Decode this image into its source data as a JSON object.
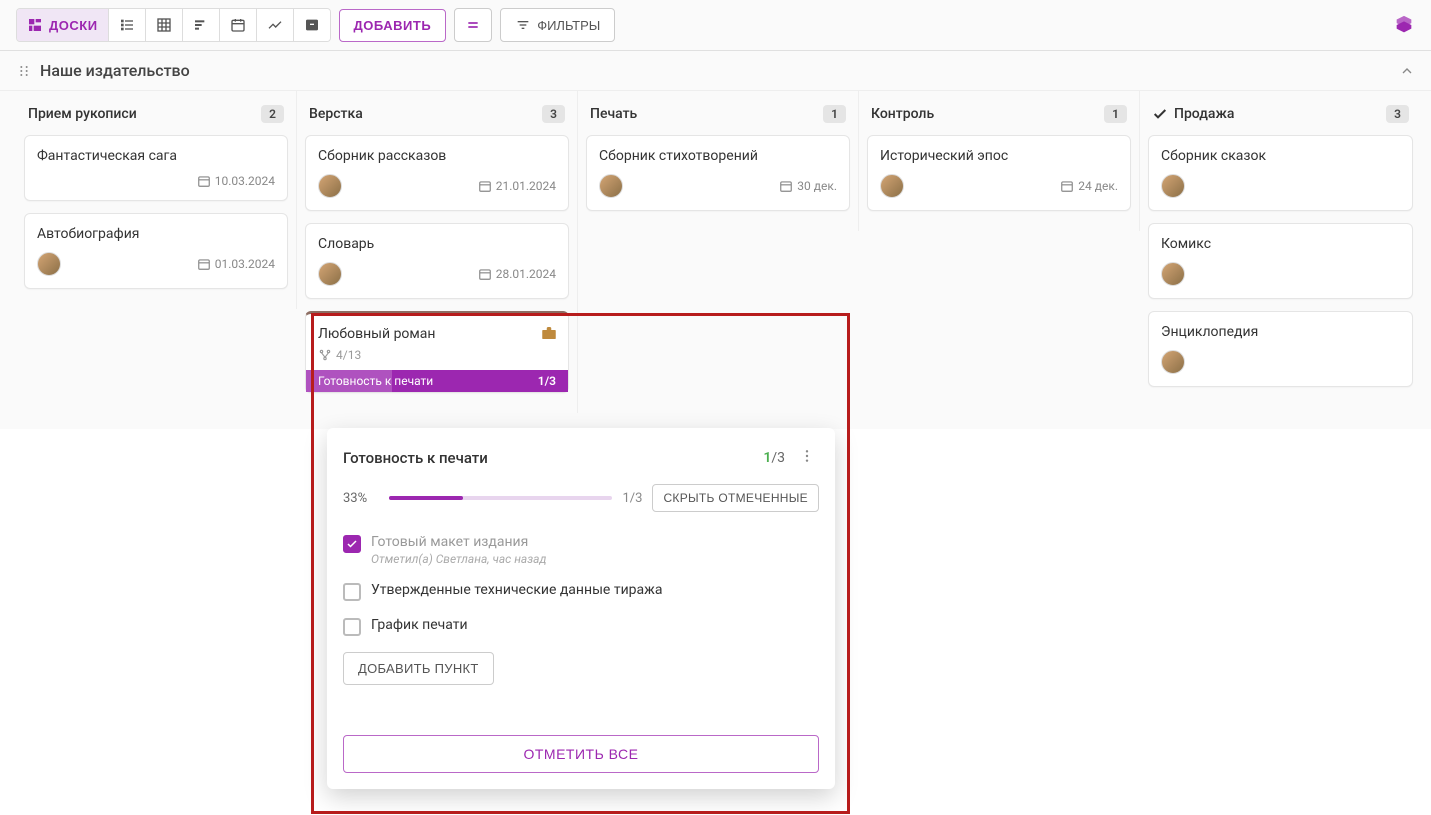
{
  "toolbar": {
    "boards_label": "ДОСКИ",
    "add_label": "ДОБАВИТЬ",
    "filters_label": "ФИЛЬТРЫ"
  },
  "board": {
    "title": "Наше издательство"
  },
  "columns": [
    {
      "title": "Прием рукописи",
      "count": "2",
      "check": false,
      "cards": [
        {
          "title": "Фантастическая сага",
          "date": "10.03.2024",
          "avatar": false
        },
        {
          "title": "Автобиография",
          "date": "01.03.2024",
          "avatar": true
        }
      ]
    },
    {
      "title": "Верстка",
      "count": "3",
      "check": false,
      "cards": [
        {
          "title": "Сборник рассказов",
          "date": "21.01.2024",
          "avatar": true
        },
        {
          "title": "Словарь",
          "date": "28.01.2024",
          "avatar": true
        }
      ],
      "special_card": {
        "title": "Любовный роман",
        "subtasks": "4/13",
        "progress_label": "Готовность к печати",
        "progress_frac": "1/3"
      }
    },
    {
      "title": "Печать",
      "count": "1",
      "check": false,
      "cards": [
        {
          "title": "Сборник стихотворений",
          "date": "30 дек.",
          "avatar": true
        }
      ]
    },
    {
      "title": "Контроль",
      "count": "1",
      "check": false,
      "cards": [
        {
          "title": "Исторический эпос",
          "date": "24 дек.",
          "avatar": true
        }
      ]
    },
    {
      "title": "Продажа",
      "count": "3",
      "check": true,
      "cards": [
        {
          "title": "Сборник сказок",
          "date": "",
          "avatar": true
        },
        {
          "title": "Комикс",
          "date": "",
          "avatar": true
        },
        {
          "title": "Энциклопедия",
          "date": "",
          "avatar": true
        }
      ]
    }
  ],
  "popup": {
    "title": "Готовность к печати",
    "done": "1",
    "total": "/3",
    "pct": "33%",
    "pfrac": "1/3",
    "hide_label": "СКРЫТЬ ОТМЕЧЕННЫЕ",
    "items": [
      {
        "label": "Готовый макет издания",
        "checked": true,
        "meta": "Отметил(а) Светлана, час назад"
      },
      {
        "label": "Утвержденные технические данные тиража",
        "checked": false,
        "meta": ""
      },
      {
        "label": "График печати",
        "checked": false,
        "meta": ""
      }
    ],
    "add_item_label": "ДОБАВИТЬ ПУНКТ",
    "mark_all_label": "ОТМЕТИТЬ ВСЕ"
  }
}
